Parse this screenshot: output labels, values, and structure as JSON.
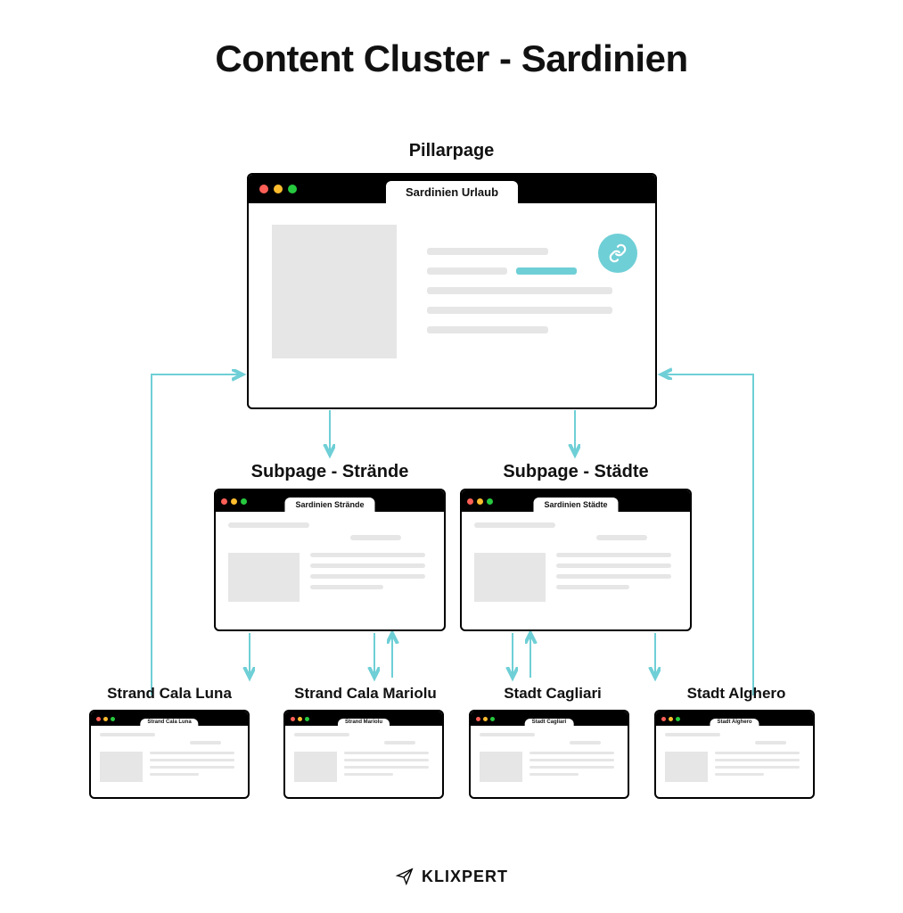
{
  "title": "Content Cluster - Sardinien",
  "pillar": {
    "label": "Pillarpage",
    "tab": "Sardinien Urlaub"
  },
  "subpages": [
    {
      "label": "Subpage - Strände",
      "tab": "Sardinien Strände"
    },
    {
      "label": "Subpage - Städte",
      "tab": "Sardinien Städte"
    }
  ],
  "details": [
    {
      "label": "Strand Cala Luna",
      "tab": "Strand Cala Luna"
    },
    {
      "label": "Strand Cala Mariolu",
      "tab": "Strand Mariolu"
    },
    {
      "label": "Stadt Cagliari",
      "tab": "Stadt Cagliari"
    },
    {
      "label": "Stadt Alghero",
      "tab": "Stadt Alghero"
    }
  ],
  "brand": "KLIXPERT",
  "colors": {
    "accent": "#6fcfd6",
    "placeholder": "#e6e6e6"
  }
}
